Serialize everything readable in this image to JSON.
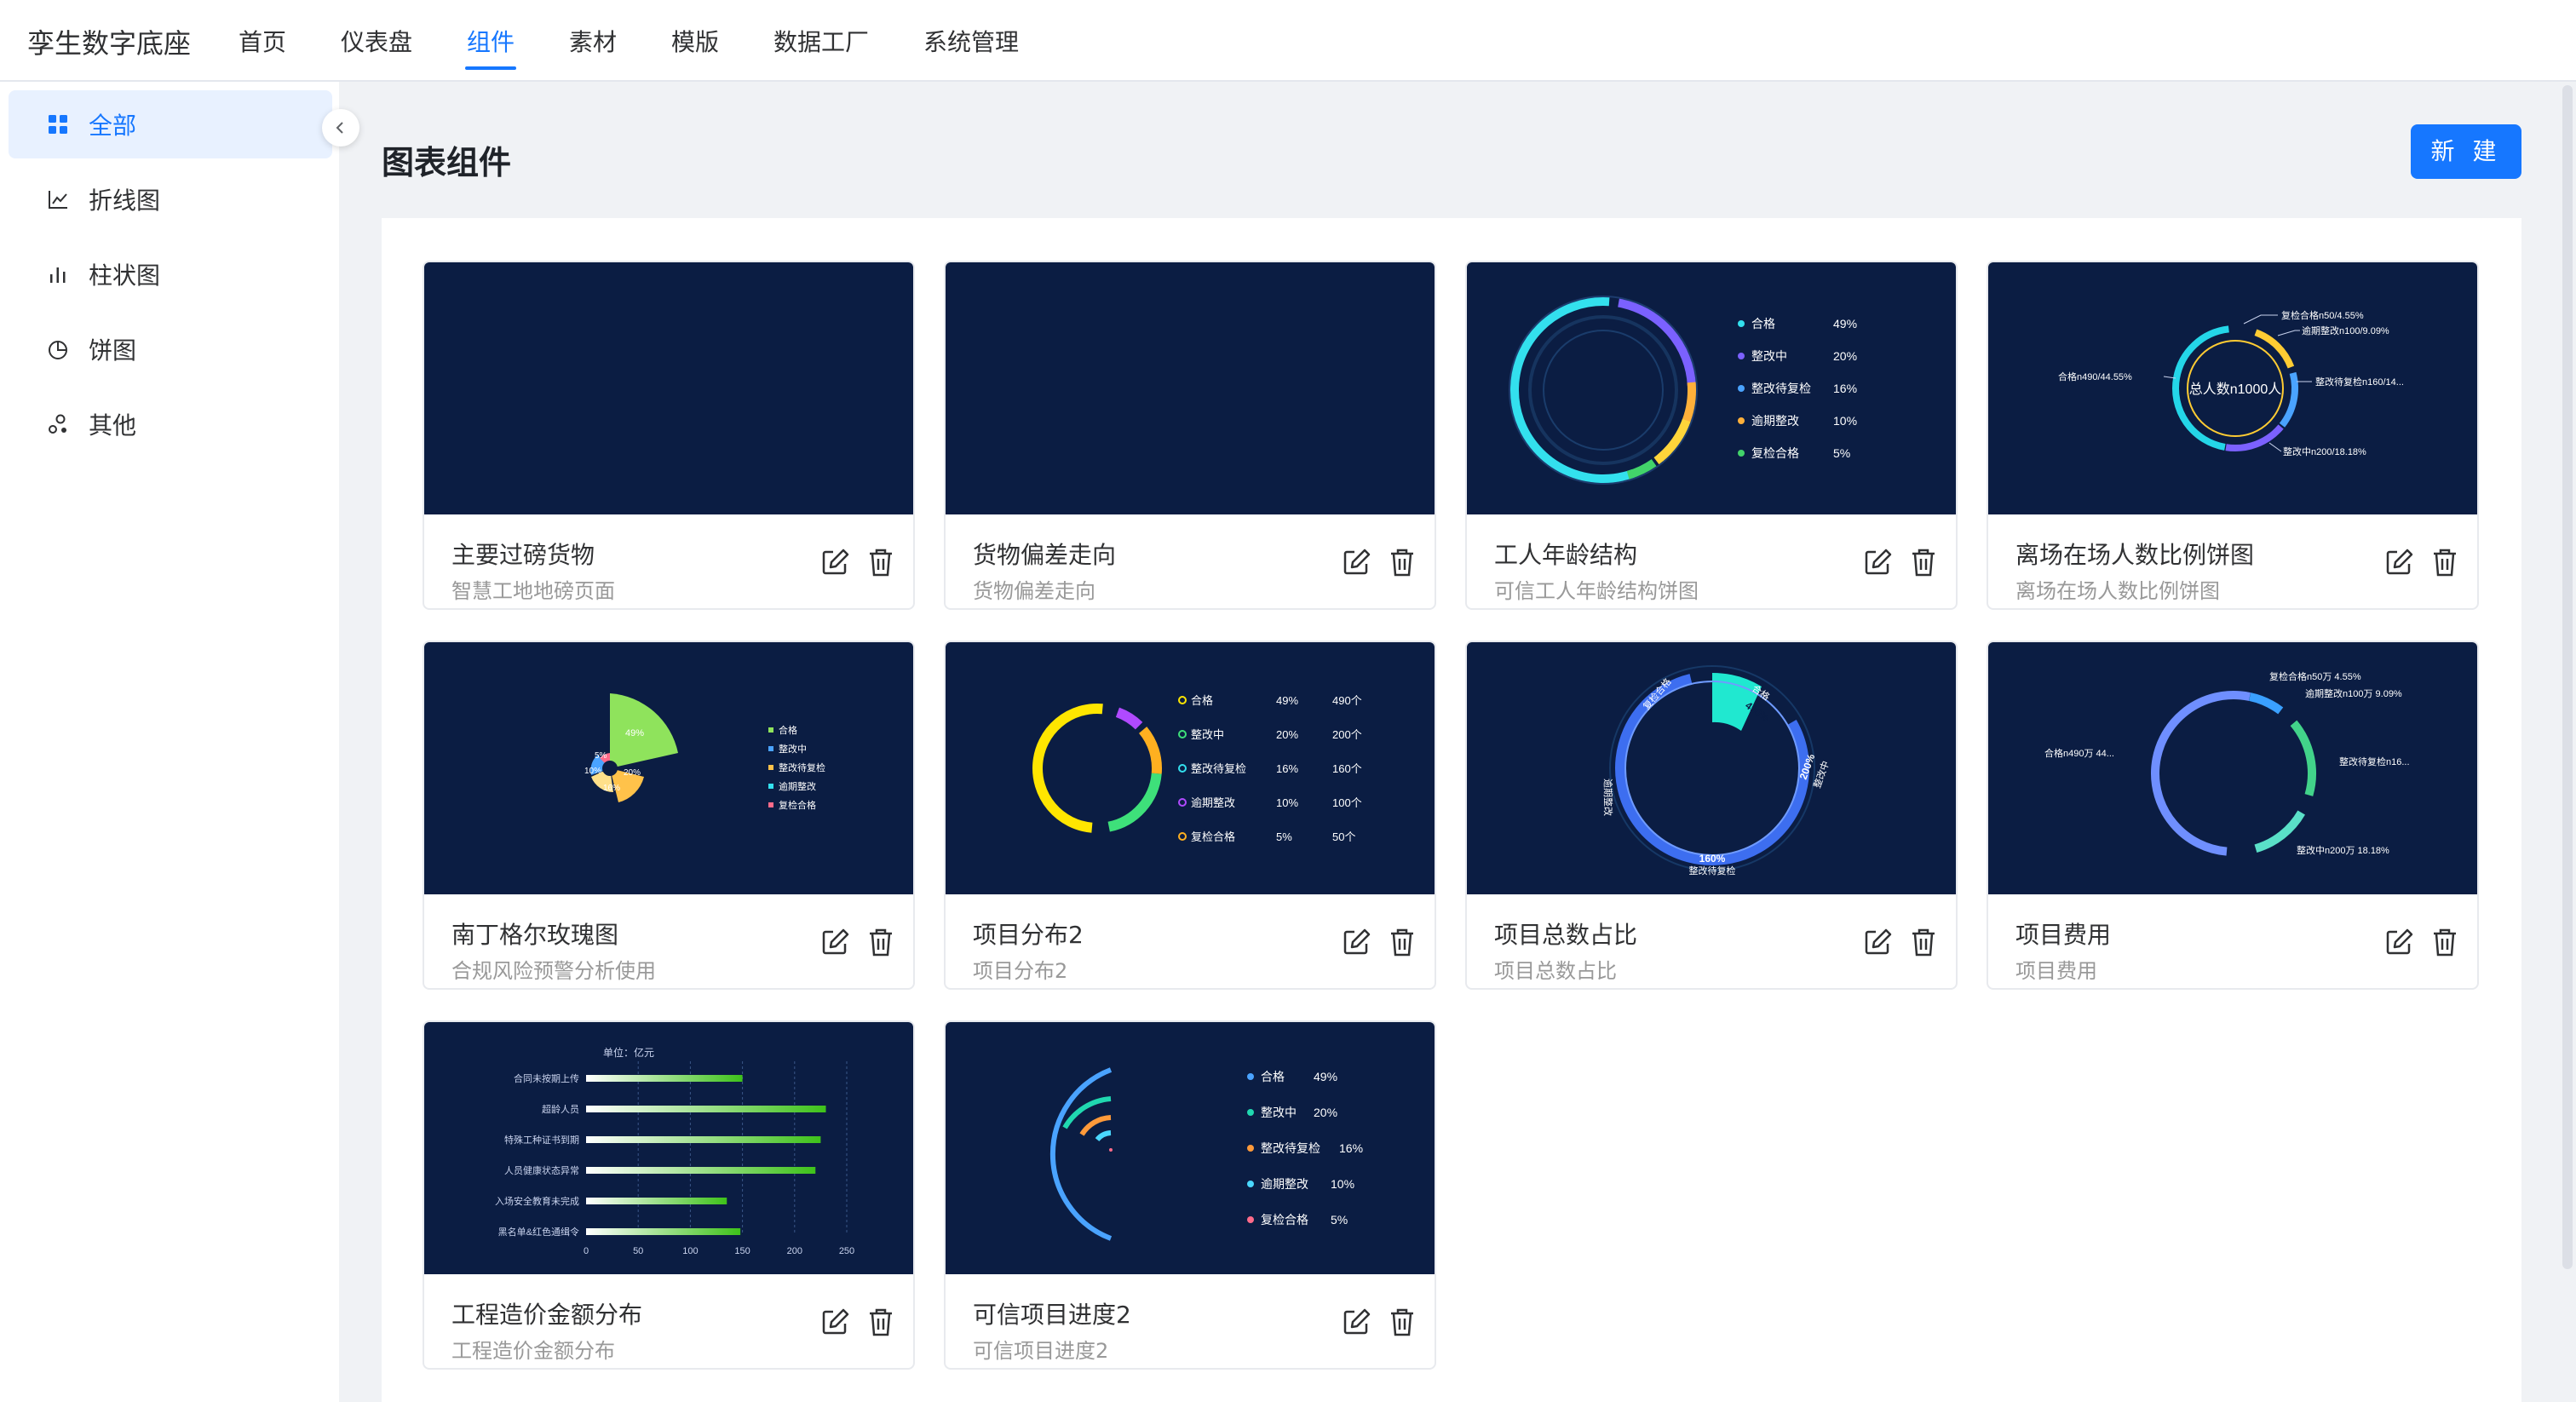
{
  "app": {
    "title": "孪生数字底座"
  },
  "nav": {
    "items": [
      {
        "label": "首页"
      },
      {
        "label": "仪表盘"
      },
      {
        "label": "组件",
        "active": true
      },
      {
        "label": "素材"
      },
      {
        "label": "模版"
      },
      {
        "label": "数据工厂"
      },
      {
        "label": "系统管理"
      }
    ]
  },
  "sidebar": {
    "items": [
      {
        "label": "全部",
        "icon": "grid-icon",
        "active": true
      },
      {
        "label": "折线图",
        "icon": "line-chart-icon"
      },
      {
        "label": "柱状图",
        "icon": "bar-chart-icon"
      },
      {
        "label": "饼图",
        "icon": "pie-chart-icon"
      },
      {
        "label": "其他",
        "icon": "other-icon"
      }
    ]
  },
  "page": {
    "title": "图表组件",
    "new_label": "新 建"
  },
  "colors": {
    "accent": "#1677ff",
    "thumb_bg": "#0b1d43"
  },
  "cards": [
    {
      "title": "主要过磅货物",
      "subtitle": "智慧工地地磅页面",
      "thumb": {
        "type": "empty"
      }
    },
    {
      "title": "货物偏差走向",
      "subtitle": "货物偏差走向",
      "thumb": {
        "type": "empty"
      }
    },
    {
      "title": "工人年龄结构",
      "subtitle": "可信工人年龄结构饼图",
      "thumb": {
        "type": "ring-legend",
        "legend": [
          {
            "name": "合格",
            "value": "49%"
          },
          {
            "name": "整改中",
            "value": "20%"
          },
          {
            "name": "整改待复检",
            "value": "16%"
          },
          {
            "name": "逾期整改",
            "value": "10%"
          },
          {
            "name": "复检合格",
            "value": "5%"
          }
        ]
      }
    },
    {
      "title": "离场在场人数比例饼图",
      "subtitle": "离场在场人数比例饼图",
      "thumb": {
        "type": "donut-callouts",
        "center_label": "总人数n1000人",
        "callouts": [
          "复检合格n50/4.55%",
          "逾期整改n100/9.09%",
          "合格n490/44.55%",
          "整改待复检n160/14...",
          "整改中n200/18.18%"
        ]
      }
    },
    {
      "title": "南丁格尔玫瑰图",
      "subtitle": "合规风险预警分析使用",
      "thumb": {
        "type": "rose",
        "slice_labels": [
          "49%",
          "5%",
          "10%",
          "20%",
          "16%"
        ],
        "legend": [
          "合格",
          "整改中",
          "整改待复检",
          "逾期整改",
          "复检合格"
        ]
      }
    },
    {
      "title": "项目分布2",
      "subtitle": "项目分布2",
      "thumb": {
        "type": "ring-table",
        "rows": [
          {
            "name": "合格",
            "pct": "49%",
            "count": "490个"
          },
          {
            "name": "整改中",
            "pct": "20%",
            "count": "200个"
          },
          {
            "name": "整改待复检",
            "pct": "16%",
            "count": "160个"
          },
          {
            "name": "逾期整改",
            "pct": "10%",
            "count": "100个"
          },
          {
            "name": "复检合格",
            "pct": "5%",
            "count": "50个"
          }
        ]
      }
    },
    {
      "title": "项目总数占比",
      "subtitle": "项目总数占比",
      "thumb": {
        "type": "segmented-ring",
        "labels": [
          "合格",
          "490%",
          "复检合格",
          "逾期整改",
          "200%",
          "整改中",
          "160%",
          "整改待复检"
        ]
      }
    },
    {
      "title": "项目费用",
      "subtitle": "项目费用",
      "thumb": {
        "type": "ring-callouts",
        "callouts": [
          "复检合格n50万 4.55%",
          "逾期整改n100万 9.09%",
          "合格n490万 44...",
          "整改待复检n16...",
          "整改中n200万 18.18%"
        ]
      }
    },
    {
      "title": "工程造价金额分布",
      "subtitle": "工程造价金额分布",
      "thumb": {
        "type": "hbar",
        "unit": "单位：亿元",
        "categories": [
          "合同未按期上传",
          "超龄人员",
          "特殊工种证书到期",
          "人员健康状态异常",
          "入场安全教育未完成",
          "黑名单&红色通缉令"
        ],
        "values": [
          150,
          230,
          225,
          220,
          135,
          148
        ],
        "ticks": [
          "0",
          "50",
          "100",
          "150",
          "200",
          "250"
        ],
        "xlim": [
          0,
          250
        ]
      }
    },
    {
      "title": "可信项目进度2",
      "subtitle": "可信项目进度2",
      "thumb": {
        "type": "arcs-legend",
        "legend": [
          {
            "name": "合格",
            "value": "49%"
          },
          {
            "name": "整改中",
            "value": "20%"
          },
          {
            "name": "整改待复检",
            "value": "16%"
          },
          {
            "name": "逾期整改",
            "value": "10%"
          },
          {
            "name": "复检合格",
            "value": "5%"
          }
        ]
      }
    }
  ]
}
